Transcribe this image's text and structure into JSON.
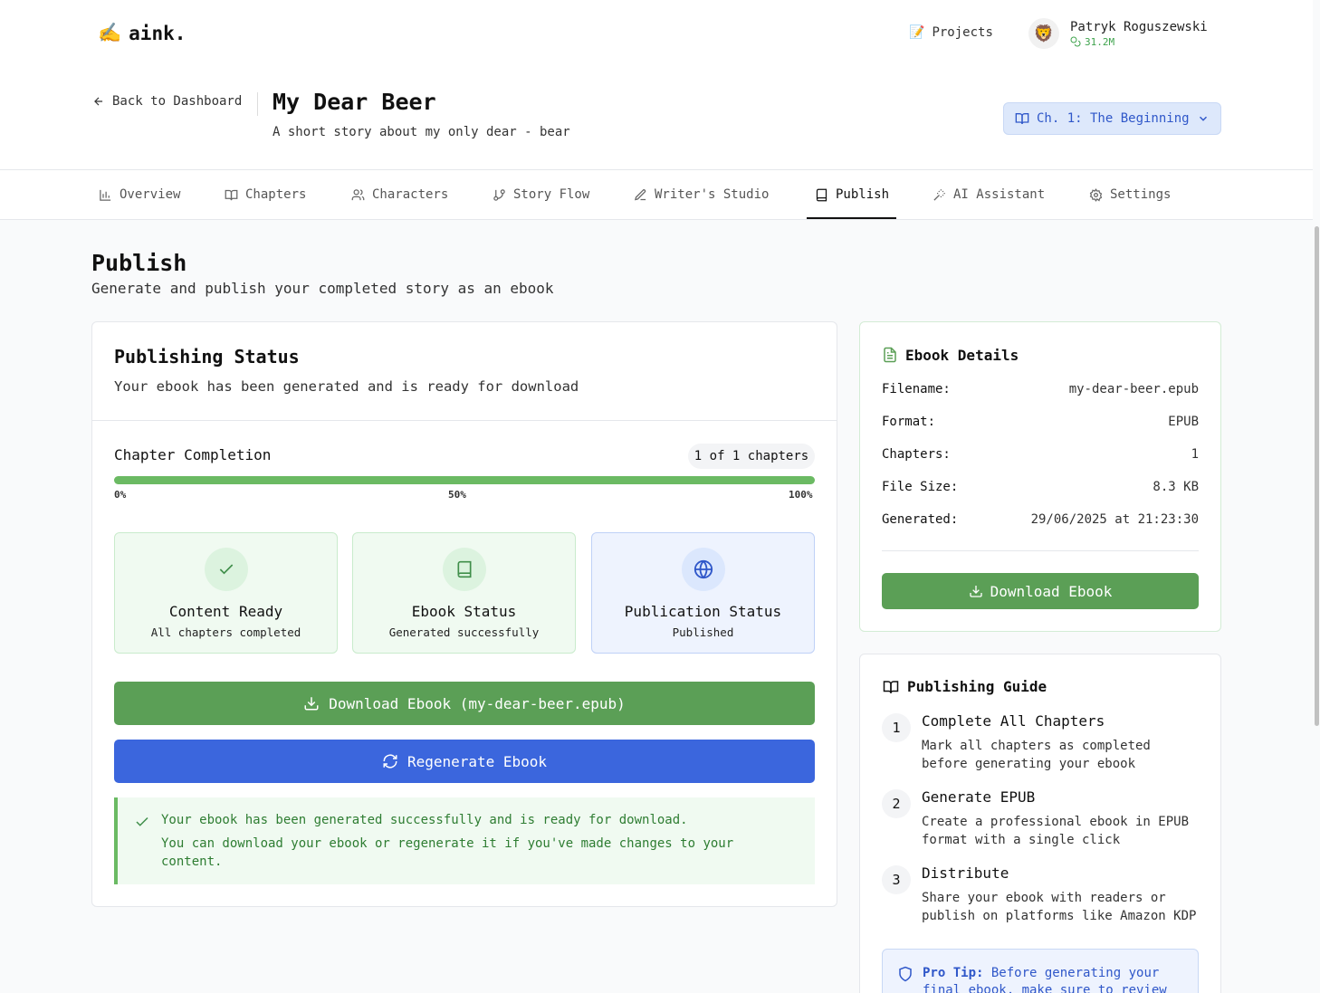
{
  "app": {
    "logo_emoji": "✍️",
    "logo_text": "aink.",
    "nav_projects_emoji": "📝",
    "nav_projects": "Projects",
    "user": {
      "avatar_emoji": "🦁",
      "name": "Patryk Roguszewski",
      "tokens": "31.2M"
    }
  },
  "project": {
    "back_label": "Back to Dashboard",
    "title": "My Dear Beer",
    "subtitle": "A short story about my only dear - bear",
    "chapter_select": "Ch. 1: The Beginning"
  },
  "tabs": [
    {
      "label": "Overview",
      "icon": "bar-chart-icon"
    },
    {
      "label": "Chapters",
      "icon": "book-open-icon"
    },
    {
      "label": "Characters",
      "icon": "users-icon"
    },
    {
      "label": "Story Flow",
      "icon": "git-branch-icon"
    },
    {
      "label": "Writer's Studio",
      "icon": "pen-icon"
    },
    {
      "label": "Publish",
      "icon": "book-icon",
      "active": true
    },
    {
      "label": "AI Assistant",
      "icon": "magic-wand-icon"
    },
    {
      "label": "Settings",
      "icon": "gear-icon"
    }
  ],
  "page": {
    "title": "Publish",
    "subtitle": "Generate and publish your completed story as an ebook"
  },
  "status": {
    "title": "Publishing Status",
    "subtitle": "Your ebook has been generated and is ready for download",
    "completion_label": "Chapter Completion",
    "completion_badge": "1 of 1 chapters",
    "progress": 1.0,
    "progress_labels": [
      "0%",
      "50%",
      "100%"
    ],
    "boxes": [
      {
        "title": "Content Ready",
        "sub": "All chapters completed",
        "icon": "check-icon"
      },
      {
        "title": "Ebook Status",
        "sub": "Generated successfully",
        "icon": "book-icon"
      },
      {
        "title": "Publication Status",
        "sub": "Published",
        "icon": "globe-icon"
      }
    ],
    "download_button": "Download Ebook (my-dear-beer.epub)",
    "regenerate_button": "Regenerate Ebook",
    "alert_line1": "Your ebook has been generated successfully and is ready for download.",
    "alert_line2": "You can download your ebook or regenerate it if you've made changes to your content."
  },
  "details": {
    "title": "Ebook Details",
    "rows": [
      {
        "label": "Filename:",
        "value": "my-dear-beer.epub"
      },
      {
        "label": "Format:",
        "value": "EPUB"
      },
      {
        "label": "Chapters:",
        "value": "1"
      },
      {
        "label": "File Size:",
        "value": "8.3 KB"
      },
      {
        "label": "Generated:",
        "value": "29/06/2025 at 21:23:30"
      }
    ],
    "download_button": "Download Ebook"
  },
  "guide": {
    "title": "Publishing Guide",
    "steps": [
      {
        "num": "1",
        "title": "Complete All Chapters",
        "desc": "Mark all chapters as completed before generating your ebook"
      },
      {
        "num": "2",
        "title": "Generate EPUB",
        "desc": "Create a professional ebook in EPUB format with a single click"
      },
      {
        "num": "3",
        "title": "Distribute",
        "desc": "Share your ebook with readers or publish on platforms like Amazon KDP"
      }
    ],
    "tip_label": "Pro Tip:",
    "tip_text": " Before generating your final ebook, make sure to review"
  },
  "colors": {
    "accent_green": "#5b9f56",
    "accent_blue": "#3b66dd",
    "progress_green": "#6bba63"
  }
}
